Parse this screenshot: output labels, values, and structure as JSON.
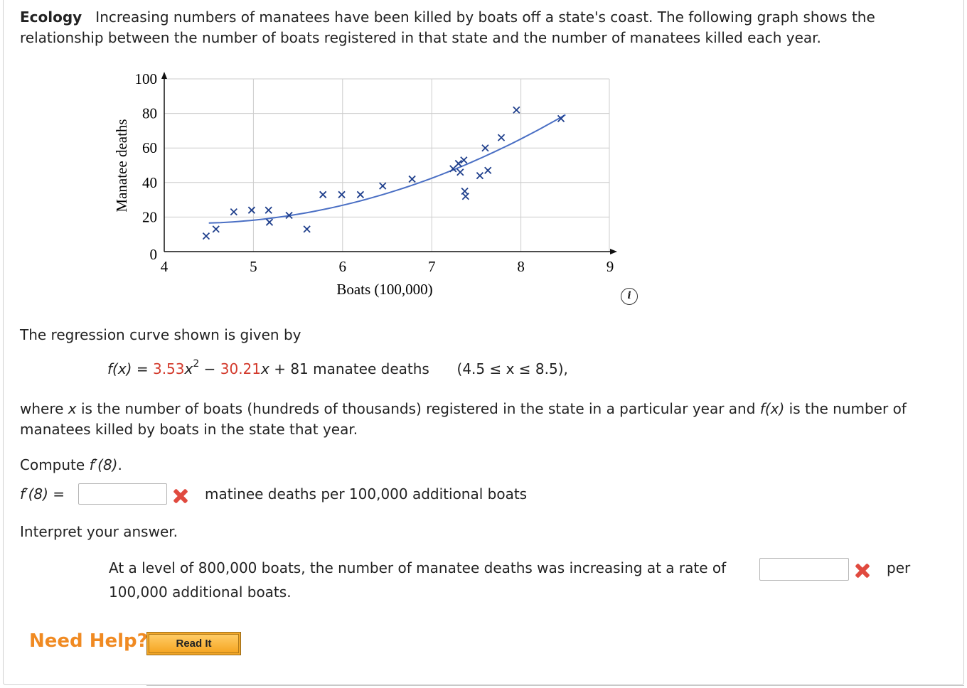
{
  "intro": {
    "topic": "Ecology",
    "text": "Increasing numbers of manatees have been killed by boats off a state's coast. The following graph shows the relationship between the number of boats registered in that state and the number of manatees killed each year."
  },
  "chart_data": {
    "type": "scatter",
    "xlabel": "Boats (100,000)",
    "ylabel": "Manatee deaths",
    "x_ticks": [
      "4",
      "5",
      "6",
      "7",
      "8",
      "9"
    ],
    "y_ticks": [
      "0",
      "20",
      "40",
      "60",
      "80",
      "100"
    ],
    "xlim": [
      4,
      9
    ],
    "ylim": [
      0,
      100
    ],
    "grid": true,
    "points": [
      {
        "x": 4.47,
        "y": 9
      },
      {
        "x": 4.58,
        "y": 13
      },
      {
        "x": 4.78,
        "y": 23
      },
      {
        "x": 4.98,
        "y": 24
      },
      {
        "x": 5.17,
        "y": 24
      },
      {
        "x": 5.18,
        "y": 17
      },
      {
        "x": 5.4,
        "y": 21
      },
      {
        "x": 5.6,
        "y": 13
      },
      {
        "x": 5.78,
        "y": 33
      },
      {
        "x": 5.99,
        "y": 33
      },
      {
        "x": 6.2,
        "y": 33
      },
      {
        "x": 6.45,
        "y": 38
      },
      {
        "x": 6.78,
        "y": 42
      },
      {
        "x": 7.24,
        "y": 48
      },
      {
        "x": 7.3,
        "y": 51
      },
      {
        "x": 7.32,
        "y": 46
      },
      {
        "x": 7.36,
        "y": 53
      },
      {
        "x": 7.37,
        "y": 35
      },
      {
        "x": 7.38,
        "y": 32
      },
      {
        "x": 7.54,
        "y": 44
      },
      {
        "x": 7.63,
        "y": 47
      },
      {
        "x": 7.6,
        "y": 60
      },
      {
        "x": 7.78,
        "y": 66
      },
      {
        "x": 7.95,
        "y": 82
      },
      {
        "x": 8.45,
        "y": 77
      }
    ],
    "curve": {
      "a": 3.53,
      "b": -30.21,
      "c": 81,
      "x_from": 4.5,
      "x_to": 8.5
    },
    "colors": {
      "marker": "#1f3f8c",
      "curve": "#4a6fc4",
      "grid": "#cccccc",
      "axis": "#111111"
    }
  },
  "info_icon": "i",
  "regression_text": "The regression curve shown is given by",
  "formula": {
    "fx": "f(x)",
    "eq": " = ",
    "a": "3.53",
    "x2": "x",
    "exp": "2",
    "minus": " − ",
    "b": "30.21",
    "xterm": "x",
    "rest": " + 81 manatee deaths",
    "domain": "(4.5 ≤ x ≤ 8.5),"
  },
  "where_text": {
    "p1": "where ",
    "x": "x",
    "p2": " is the number of boats (hundreds of thousands) registered in the state in a particular year and ",
    "fx": "f(x)",
    "p3": " is the number of manatees killed by boats in the state that year."
  },
  "compute": {
    "label": "Compute ",
    "fprime": "f′(8)",
    "end": "."
  },
  "answer1": {
    "label": "f′(8)",
    "eq": " = ",
    "value": "",
    "units": "matinee deaths per 100,000 additional boats"
  },
  "interpret": "Interpret your answer.",
  "answer2": {
    "before": "At a level of 800,000 boats, the number of manatee deaths was increasing at a rate of",
    "value": "",
    "per": "per",
    "after": "100,000 additional boats."
  },
  "help": {
    "label": "Need Help?",
    "button": "Read It"
  }
}
